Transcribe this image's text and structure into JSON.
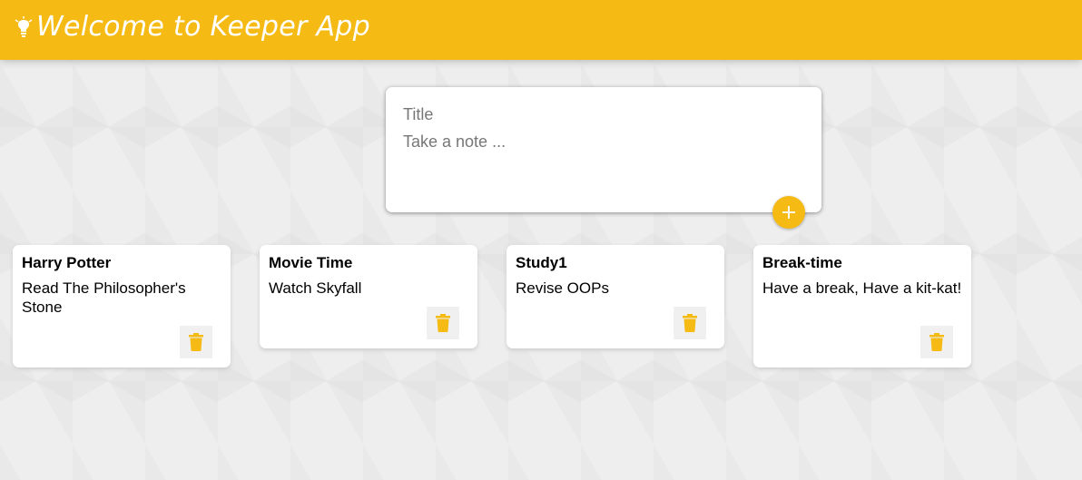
{
  "header": {
    "title": "Welcome to Keeper App",
    "icon": "lightbulb-icon",
    "color": "#f5ba13"
  },
  "create_note": {
    "title_placeholder": "Title",
    "content_placeholder": "Take a note ...",
    "add_icon": "plus-icon"
  },
  "notes": [
    {
      "title": "Harry Potter",
      "content": "Read The Philosopher's Stone",
      "delete_icon": "trash-icon"
    },
    {
      "title": "Movie Time",
      "content": "Watch Skyfall",
      "delete_icon": "trash-icon"
    },
    {
      "title": "Study1",
      "content": "Revise OOPs",
      "delete_icon": "trash-icon"
    },
    {
      "title": "Break-time",
      "content": "Have a break, Have a kit-kat!",
      "delete_icon": "trash-icon"
    }
  ],
  "colors": {
    "accent": "#f5ba13",
    "background": "#eeeeee",
    "card": "#ffffff"
  }
}
